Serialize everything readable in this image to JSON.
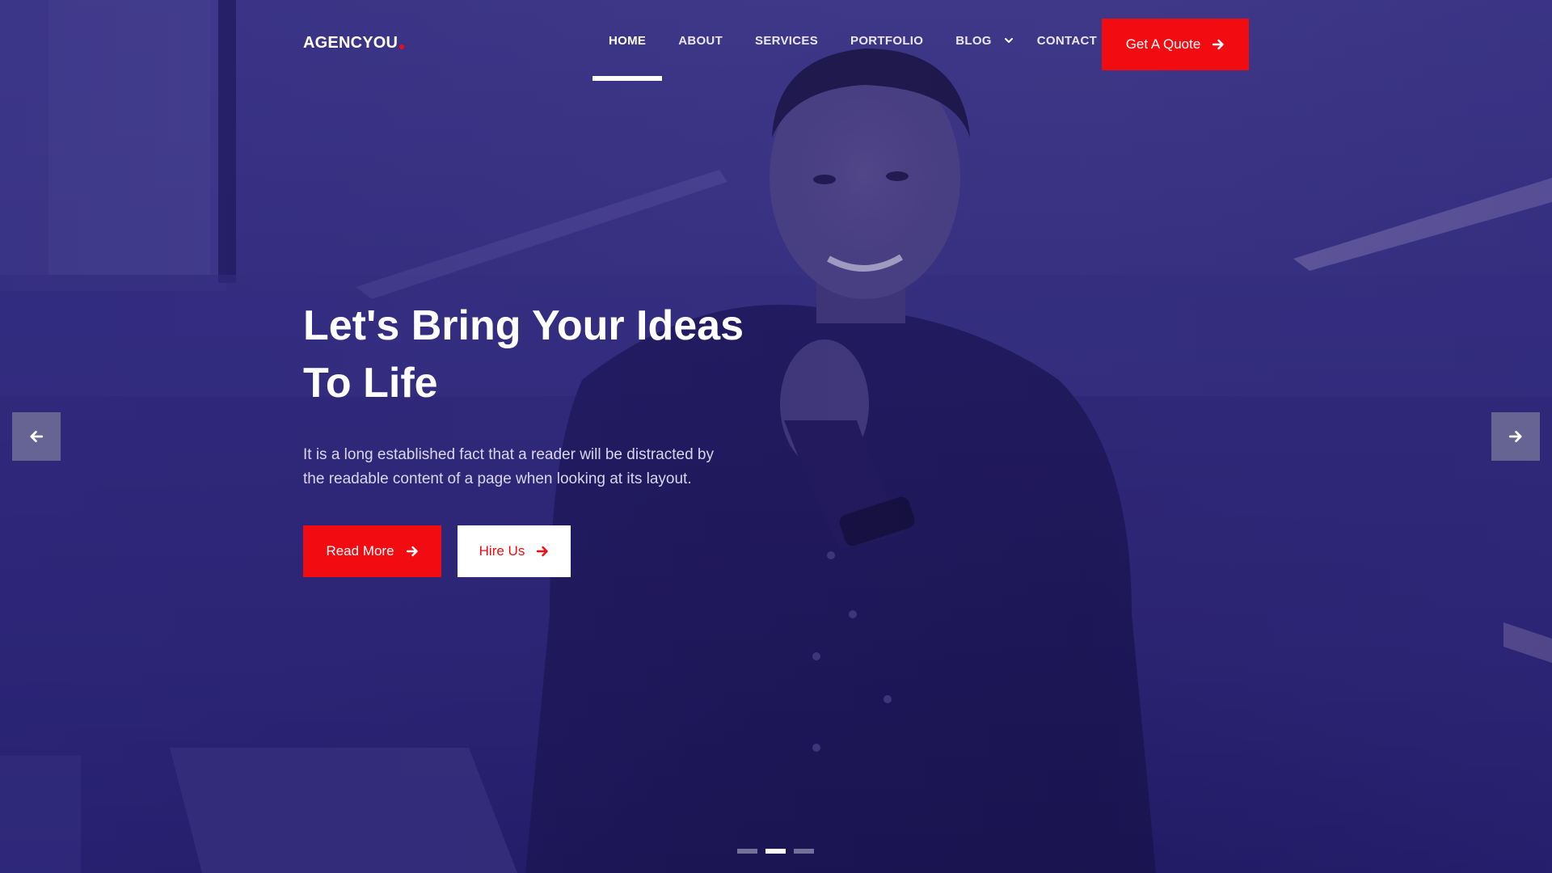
{
  "colors": {
    "accent": "#f30b12",
    "overlay": "#2e2877",
    "white": "#ffffff"
  },
  "brand": {
    "name": "AGENCYOU"
  },
  "nav": {
    "items": [
      {
        "label": "HOME",
        "active": true
      },
      {
        "label": "ABOUT"
      },
      {
        "label": "SERVICES"
      },
      {
        "label": "PORTFOLIO"
      },
      {
        "label": "BLOG",
        "has_dropdown": true,
        "icon": "chevron-down-icon"
      },
      {
        "label": "CONTACT"
      }
    ]
  },
  "header": {
    "quote_button": {
      "label": "Get A Quote",
      "icon": "arrow-right-icon"
    }
  },
  "hero": {
    "headline_line1": "Let's Bring Your Ideas",
    "headline_line2": "To Life",
    "description_line1": "It is a long established fact that a reader will be distracted by",
    "description_line2": "the readable content of a page when looking at its layout.",
    "primary_button": {
      "label": "Read More",
      "icon": "arrow-right-icon"
    },
    "secondary_button": {
      "label": "Hire Us",
      "icon": "arrow-right-icon"
    }
  },
  "slider": {
    "prev_icon": "arrow-left-icon",
    "next_icon": "arrow-right-icon",
    "dots_count": 3,
    "active_dot": 2
  }
}
